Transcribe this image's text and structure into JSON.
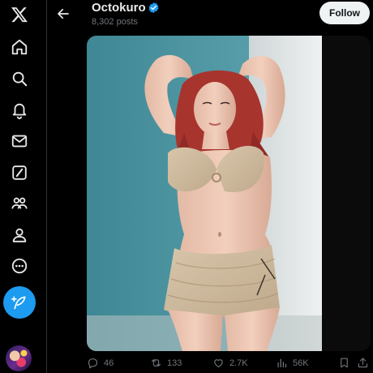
{
  "header": {
    "title": "Octokuro",
    "subtitle": "8,302 posts",
    "follow_label": "Follow"
  },
  "nav": {
    "items": [
      "x-logo-icon",
      "home-icon",
      "explore-icon",
      "notifications-icon",
      "messages-icon",
      "grok-icon",
      "communities-icon",
      "profile-icon",
      "more-icon"
    ],
    "post_button_icon": "feather-plus-icon"
  },
  "actions": {
    "replies": "46",
    "reposts": "133",
    "likes": "2.7K",
    "views": "56K"
  },
  "colors": {
    "background": "#000000",
    "accent": "#1d9bf0",
    "text": "#e7e9ea",
    "muted": "#71767b",
    "follow_bg": "#eff3f4"
  }
}
